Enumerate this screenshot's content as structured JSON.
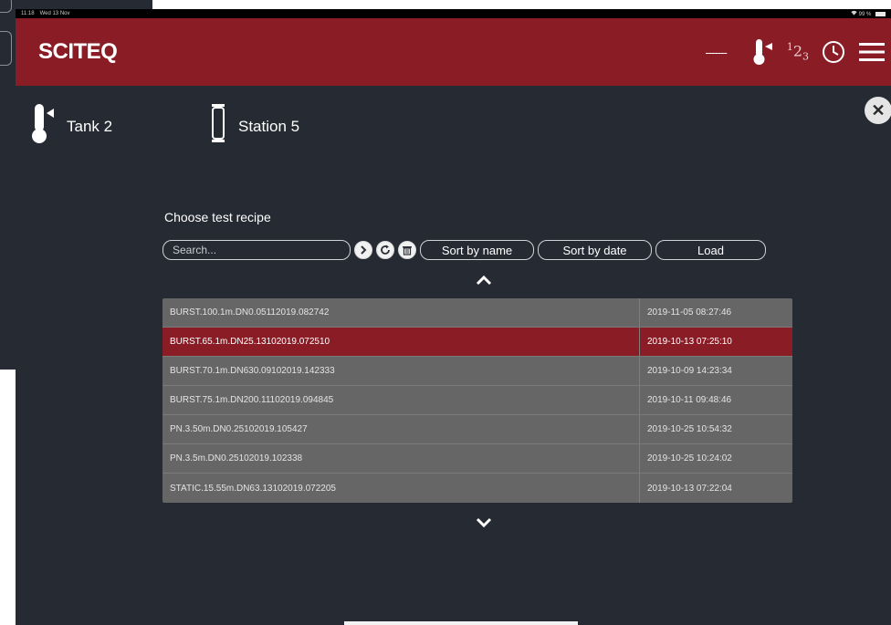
{
  "status_bar": {
    "time": "11:18",
    "date": "Wed 13 Nov",
    "battery": "99 %"
  },
  "header": {
    "brand": "SCITEQ",
    "temperature_reading": "-------",
    "icons": [
      "thermometer-icon",
      "numbering-icon",
      "clock-icon",
      "menu-icon"
    ]
  },
  "station_bar": {
    "tank_label": "Tank 2",
    "station_label": "Station 5"
  },
  "recipe_panel": {
    "title": "Choose test recipe",
    "search_placeholder": "Search...",
    "sort_by_name": "Sort by name",
    "sort_by_date": "Sort by date",
    "load": "Load",
    "rows": [
      {
        "name": "BURST.100.1m.DN0.05112019.082742",
        "date": "2019-11-05 08:27:46",
        "selected": false
      },
      {
        "name": "BURST.65.1m.DN25.13102019.072510",
        "date": "2019-10-13 07:25:10",
        "selected": true
      },
      {
        "name": "BURST.70.1m.DN630.09102019.142333",
        "date": "2019-10-09 14:23:34",
        "selected": false
      },
      {
        "name": "BURST.75.1m.DN200.11102019.094845",
        "date": "2019-10-11 09:48:46",
        "selected": false
      },
      {
        "name": "PN.3.50m.DN0.25102019.105427",
        "date": "2019-10-25 10:54:32",
        "selected": false
      },
      {
        "name": "PN.3.5m.DN0.25102019.102338",
        "date": "2019-10-25 10:24:02",
        "selected": false
      },
      {
        "name": "STATIC.15.55m.DN63.13102019.072205",
        "date": "2019-10-13 07:22:04",
        "selected": false
      }
    ]
  },
  "colors": {
    "brand_red": "#8a1c26",
    "background": "#252a33",
    "table_row": "#666666"
  }
}
